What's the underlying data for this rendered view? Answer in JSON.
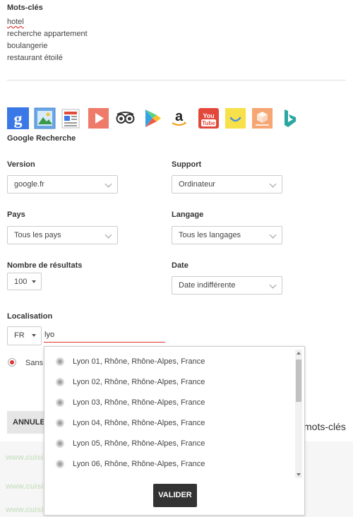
{
  "keywords": {
    "label": "Mots-clés",
    "items": [
      "hotel",
      "recherche appartement",
      "boulangerie",
      "restaurant étoilé"
    ]
  },
  "engines": {
    "icons": [
      "google-icon",
      "google-images-icon",
      "google-news-icon",
      "youtube-play-icon",
      "tripadvisor-icon",
      "google-play-icon",
      "amazon-icon",
      "youtube-icon",
      "smiley-icon",
      "box-icon",
      "bing-icon"
    ],
    "selected_label": "Google Recherche"
  },
  "version": {
    "label": "Version",
    "value": "google.fr"
  },
  "support": {
    "label": "Support",
    "value": "Ordinateur"
  },
  "pays": {
    "label": "Pays",
    "value": "Tous les pays"
  },
  "langage": {
    "label": "Langage",
    "value": "Tous les langages"
  },
  "nombre": {
    "label": "Nombre de résultats",
    "value": "100"
  },
  "date": {
    "label": "Date",
    "value": "Date indifférente"
  },
  "localisation": {
    "label": "Localisation",
    "country": "FR",
    "query": "lyo",
    "radio_label": "Sans"
  },
  "dropdown": {
    "options": [
      "Lyon 01, Rhône, Rhône-Alpes, France",
      "Lyon 02, Rhône, Rhône-Alpes, France",
      "Lyon 03, Rhône, Rhône-Alpes, France",
      "Lyon 04, Rhône, Rhône-Alpes, France",
      "Lyon 05, Rhône, Rhône-Alpes, France",
      "Lyon 06, Rhône, Rhône-Alpes, France"
    ],
    "confirm_label": "VALIDER"
  },
  "footer": {
    "cancel_label": "ANNULER",
    "right_text": "mots-clés"
  },
  "background": {
    "lines": [
      "www.cuisi",
      "www.cuisi",
      "www.cuisi"
    ]
  },
  "colors": {
    "accent_red": "#d33333",
    "dark_button": "#333333"
  }
}
